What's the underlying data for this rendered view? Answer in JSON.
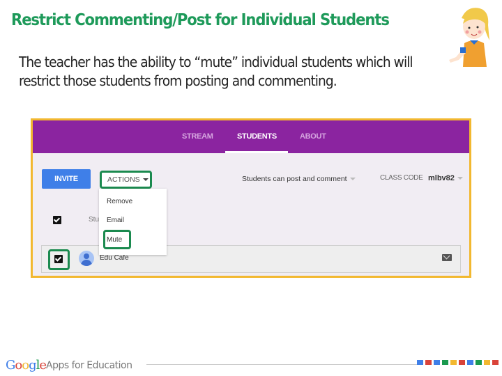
{
  "slide": {
    "title": "Restrict Commenting/Post for Individual Students",
    "body": "The teacher has the ability to “mute” individual students which will restrict those students from posting and commenting."
  },
  "mascot": {
    "icon": "cartoon-teacher-girl"
  },
  "classroom": {
    "tabs": [
      {
        "label": "STREAM",
        "active": false
      },
      {
        "label": "STUDENTS",
        "active": true
      },
      {
        "label": "ABOUT",
        "active": false
      }
    ],
    "invite_label": "INVITE",
    "actions_label": "ACTIONS",
    "actions_menu": [
      "Remove",
      "Email",
      "Mute"
    ],
    "permission_setting": "Students can post and comment",
    "class_code_label": "CLASS CODE",
    "class_code_value": "mlbv82",
    "column_header": "Students",
    "students": [
      {
        "name": "Edu Cafe",
        "checked": true
      }
    ],
    "colors": {
      "topbar": "#8b24a0",
      "invite": "#3f7fe8",
      "highlight": "#1b8a4f",
      "frame": "#f2b830"
    }
  },
  "footer": {
    "logo_letters": [
      {
        "ch": "G",
        "color": "#3f7fe8"
      },
      {
        "ch": "o",
        "color": "#d9433a"
      },
      {
        "ch": "o",
        "color": "#f2b830"
      },
      {
        "ch": "g",
        "color": "#3f7fe8"
      },
      {
        "ch": "l",
        "color": "#1b9a4f"
      },
      {
        "ch": "e",
        "color": "#d9433a"
      }
    ],
    "text": "Apps for Education",
    "squares": [
      "#3f7fe8",
      "#d9433a",
      "#3f7fe8",
      "#1b9a4f",
      "#f2b830",
      "#d9433a",
      "#3f7fe8",
      "#1b9a4f",
      "#f2b830",
      "#d9433a"
    ]
  }
}
